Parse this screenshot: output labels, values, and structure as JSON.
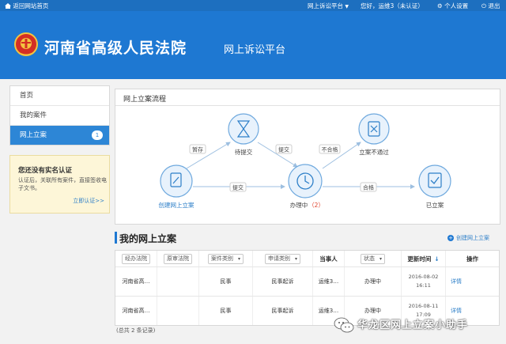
{
  "topbar": {
    "home_link": "返回网站首页",
    "platform_menu": "网上诉讼平台",
    "greeting": "您好，运维3（未认证）",
    "settings": "个人设置",
    "logout": "退出"
  },
  "header": {
    "court_name": "河南省高级人民法院",
    "platform_name": "网上诉讼平台"
  },
  "menu": {
    "items": [
      {
        "label": "首页"
      },
      {
        "label": "我的案件"
      },
      {
        "label": "网上立案",
        "badge": "1"
      }
    ]
  },
  "notice": {
    "title": "您还没有实名认证",
    "text": "认证后，关联所有案件，直接签收电子文书。",
    "link": "立即认证>>"
  },
  "flow": {
    "title": "网上立案流程",
    "nodes": {
      "create": "创建网上立案",
      "pending": "待提交",
      "processing": "办理中",
      "processing_count": "（2）",
      "rejected": "立案不通过",
      "filed": "已立案"
    },
    "edges": {
      "save": "暂存",
      "submit_top": "提交",
      "submit_mid": "提交",
      "fail": "不合格",
      "pass": "合格"
    }
  },
  "cases": {
    "title": "我的网上立案",
    "new_button": "创建网上立案",
    "filters": {
      "court": "经办法院",
      "origin_court": "原审法院",
      "case_type": "案件类别",
      "apply_type": "申请类别",
      "party": "当事人",
      "status": "状态",
      "updated": "更新时间",
      "action": "操作"
    },
    "rows": [
      {
        "court": "河南省高…",
        "origin": "",
        "case_type": "民事",
        "apply_type": "民事起诉",
        "party": "运维3…",
        "status": "办理中",
        "date": "2016-08-02",
        "time": "16:11",
        "action": "详情"
      },
      {
        "court": "河南省高…",
        "origin": "",
        "case_type": "民事",
        "apply_type": "民事起诉",
        "party": "运维3…",
        "status": "办理中",
        "date": "2016-08-11",
        "time": "17:09",
        "action": "详情"
      }
    ],
    "total": "(总共 2 条记录)"
  },
  "watermark": "华龙区网上立案小助手",
  "colors": {
    "header_blue": "#1e78d2",
    "active_blue": "#2d86d6",
    "link_blue": "#2d7fc8",
    "notice_bg": "#fdf6d8"
  }
}
